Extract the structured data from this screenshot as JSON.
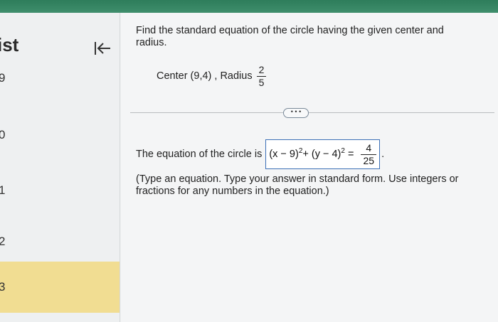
{
  "sidebar": {
    "title": "ist",
    "items": [
      {
        "label": "9"
      },
      {
        "label": "0"
      },
      {
        "label": "1"
      },
      {
        "label": "2"
      },
      {
        "label": "3"
      }
    ]
  },
  "question": {
    "prompt": "Find the standard equation of the circle having the given center and radius.",
    "center_label": "Center (9,4) , Radius",
    "radius_numerator": "2",
    "radius_denominator": "5"
  },
  "more_button": "• • •",
  "answer": {
    "lead": "The equation of the circle is",
    "lhs_part1": "(x − 9)",
    "exp1": "2",
    "lhs_part2": " + (y − 4)",
    "exp2": "2",
    "equals": " = ",
    "rhs_numerator": "4",
    "rhs_denominator": "25",
    "period": "."
  },
  "instructions": "(Type an equation. Type your answer in standard form. Use integers or fractions for any numbers in the equation.)",
  "colors": {
    "topbar": "#2e7d5b",
    "active_item": "#f1dd92",
    "answer_border": "#3b6fb6"
  }
}
